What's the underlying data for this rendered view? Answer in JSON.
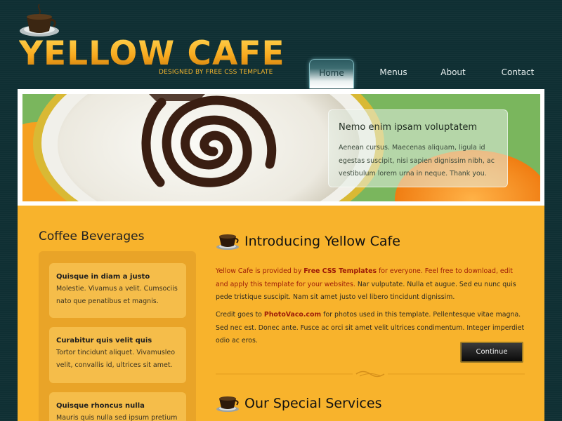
{
  "header": {
    "title": "YELLOW CAFE",
    "tagline": "DESIGNED BY FREE CSS TEMPLATE"
  },
  "nav": {
    "items": [
      {
        "label": "Home",
        "active": true
      },
      {
        "label": "Menus",
        "active": false
      },
      {
        "label": "About",
        "active": false
      },
      {
        "label": "Contact",
        "active": false
      }
    ]
  },
  "banner": {
    "heading": "Nemo enim ipsam voluptatem",
    "text": "Aenean cursus. Maecenas aliquam, ligula id egestas suscipit, nisi sapien dignissim nibh, ac vestibulum lorem urna in neque. Thank you."
  },
  "sidebar": {
    "title": "Coffee Beverages",
    "items": [
      {
        "title": "Quisque in diam a justo",
        "text": "Molestie. Vivamus a velit. Cumsociis nato que penatibus et magnis."
      },
      {
        "title": "Curabitur quis velit quis",
        "text": "Tortor tincidunt aliquet. Vivamusleo velit, convallis id, ultrices sit amet."
      },
      {
        "title": "Quisque rhoncus nulla",
        "text": "Mauris quis nulla sed ipsum pretium"
      }
    ]
  },
  "main": {
    "intro": {
      "heading": "Introducing Yellow Cafe",
      "p1_a": "Yellow Cafe is provided by ",
      "p1_link": "Free CSS Templates",
      "p1_b": " for everyone. Feel free to download, edit and apply this template for your websites.",
      "p1_c": " Nar vulputate. Nulla et augue. Sed eu nunc quis pede tristique suscipit. Nam sit amet justo vel libero tincidunt dignissim.",
      "p2_a": "Credit goes to ",
      "p2_link": "PhotoVaco.com",
      "p2_b": " for photos used in this template. Pellentesque vitae magna. Sed nec est. Donec ante. Fusce ac orci sit amet velit ultrices condimentum. Integer imperdiet odio ac eros.",
      "continue_label": "Continue"
    },
    "services": {
      "heading": "Our Special Services"
    }
  },
  "colors": {
    "background": "#0f2f33",
    "content": "#f8b32c",
    "accent_red": "#9c1a08",
    "title_gold": "#f2a51c"
  },
  "icons": [
    "coffee-cup-logo-icon",
    "coffee-cup-icon",
    "ornament-divider-icon"
  ]
}
